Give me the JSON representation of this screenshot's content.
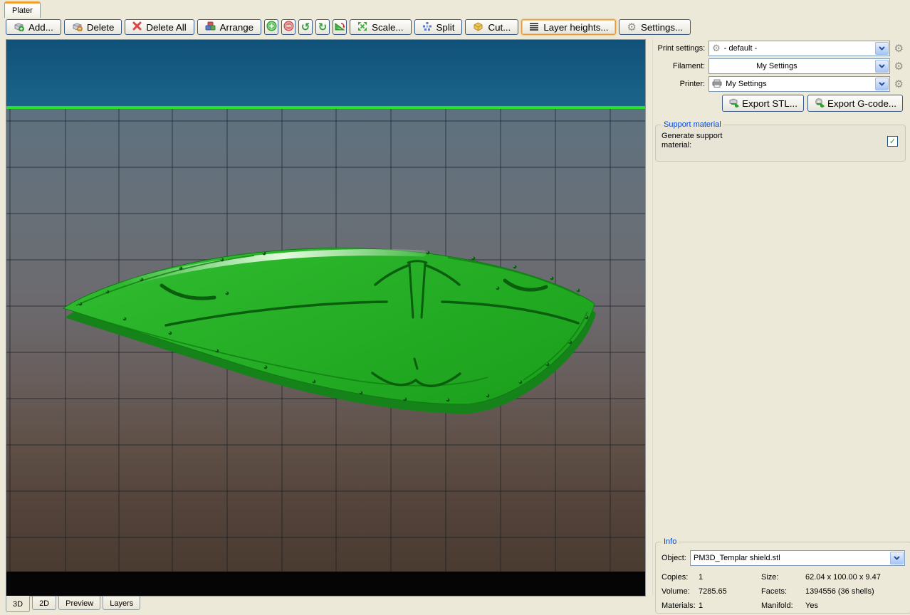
{
  "window": {
    "tab_label": "Plater"
  },
  "toolbar": {
    "add": "Add...",
    "delete": "Delete",
    "delete_all": "Delete All",
    "arrange": "Arrange",
    "scale": "Scale...",
    "split": "Split",
    "cut": "Cut...",
    "layer_heights": "Layer heights...",
    "settings": "Settings..."
  },
  "icons": {
    "gear": "⚙",
    "rotate_ccw": "↺",
    "rotate_cw": "↻",
    "plus": "+",
    "minus": "−",
    "delete_all_x": "✖",
    "check": "✓"
  },
  "settings_panel": {
    "print_settings_label": "Print settings:",
    "print_settings_value": "- default -",
    "filament_label": "Filament:",
    "filament_value": "My Settings",
    "printer_label": "Printer:",
    "printer_value": "My Settings",
    "export_stl": "Export STL...",
    "export_gcode": "Export G-code..."
  },
  "support": {
    "legend": "Support material",
    "generate_label": "Generate support material:",
    "checked": true
  },
  "info": {
    "legend": "Info",
    "object_label": "Object:",
    "object_value": "PM3D_Templar shield.stl",
    "copies_label": "Copies:",
    "copies": "1",
    "size_label": "Size:",
    "size": "62.04 x 100.00 x 9.47",
    "volume_label": "Volume:",
    "volume": "7285.65",
    "facets_label": "Facets:",
    "facets": "1394556 (36 shells)",
    "materials_label": "Materials:",
    "materials": "1",
    "manifold_label": "Manifold:",
    "manifold": "Yes"
  },
  "view_tabs": [
    {
      "label": "3D",
      "active": true
    },
    {
      "label": "2D",
      "active": false
    },
    {
      "label": "Preview",
      "active": false
    },
    {
      "label": "Layers",
      "active": false
    }
  ],
  "viewport": {
    "object_shown": "PM3D_Templar shield.stl",
    "colors": {
      "model_green": "#2db82d",
      "sky_top": "#10517a",
      "sky_bottom": "#1b6589",
      "bed_line_green": "#28e228",
      "ground_top": "#5e7180",
      "ground_bottom": "#4a3b31",
      "focus_orange": "#f0a030",
      "legend_blue": "#0046d5"
    }
  }
}
